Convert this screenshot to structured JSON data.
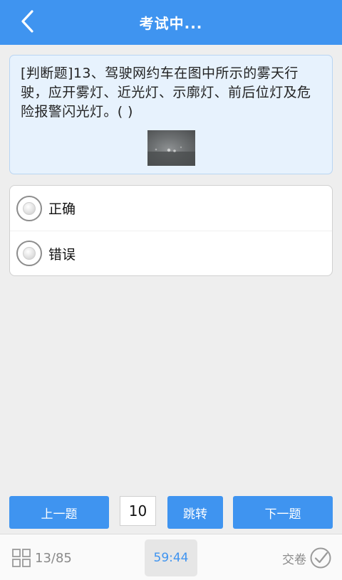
{
  "header": {
    "title": "考试中...",
    "back_icon": "chevron-left-icon"
  },
  "question": {
    "text": "[判断题]13、驾驶网约车在图中所示的雾天行驶，应开雾灯、近光灯、示廓灯、前后位灯及危险报警闪光灯。( )",
    "image": "foggy-road-image"
  },
  "options": [
    {
      "label": "正确"
    },
    {
      "label": "错误"
    }
  ],
  "navigation": {
    "prev_label": "上一题",
    "jump_value": "10",
    "jump_label": "跳转",
    "next_label": "下一题"
  },
  "footer": {
    "progress": "13/85",
    "progress_icon": "grid-icon",
    "timer": "59:44",
    "submit_label": "交卷",
    "submit_icon": "check-circle-icon"
  },
  "colors": {
    "primary": "#3f94f0",
    "question_bg": "#e7f2fd",
    "page_bg": "#eeeeee"
  }
}
